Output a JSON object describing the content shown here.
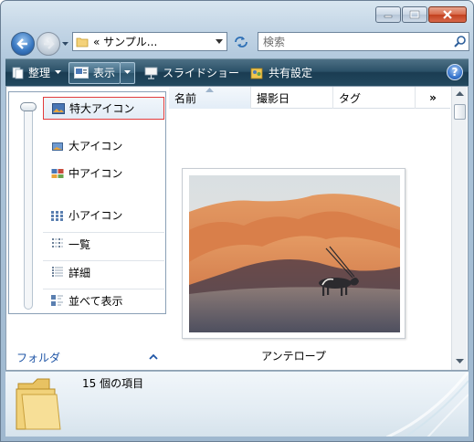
{
  "window": {
    "address": {
      "prefix": "«",
      "path": "サンプル..."
    },
    "search": {
      "placeholder": "検索"
    }
  },
  "toolbar": {
    "organize": "整理",
    "view": "表示",
    "slideshow": "スライドショー",
    "share": "共有設定",
    "help": "?"
  },
  "views_menu": {
    "items": [
      {
        "label": "特大アイコン",
        "icon": "extra-large-icons-icon",
        "selected": true
      },
      {
        "label": "大アイコン",
        "icon": "large-icons-icon"
      },
      {
        "label": "中アイコン",
        "icon": "medium-icons-icon"
      },
      {
        "label": "小アイコン",
        "icon": "small-icons-icon"
      },
      {
        "label": "一覧",
        "icon": "list-icon"
      },
      {
        "label": "詳細",
        "icon": "details-icon"
      },
      {
        "label": "並べて表示",
        "icon": "tiles-icon"
      }
    ]
  },
  "folders_bar": {
    "label": "フォルダ"
  },
  "columns": {
    "name": "名前",
    "date": "撮影日",
    "tag": "タグ",
    "more": "»"
  },
  "file": {
    "name": "アンテロープ"
  },
  "details": {
    "count": "15 個の項目"
  },
  "colors": {
    "toolbar": "#23495f",
    "selection_border": "#e23b3b",
    "link": "#1f55a6"
  }
}
